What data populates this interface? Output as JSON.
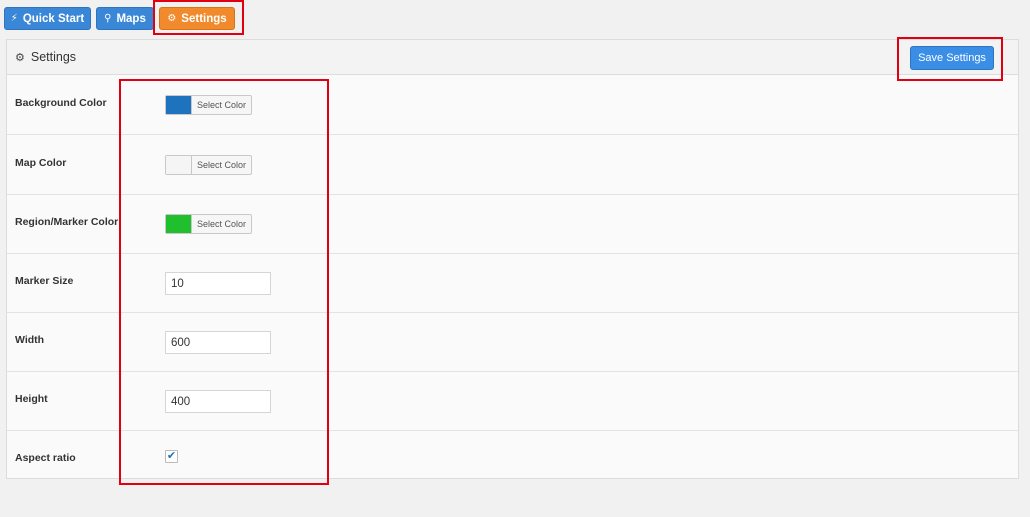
{
  "tabs": [
    {
      "label": "Quick Start",
      "icon": "bolt-icon",
      "color": "#3a87d8"
    },
    {
      "label": "Maps",
      "icon": "map-marker-icon",
      "color": "#3a87d8"
    },
    {
      "label": "Settings",
      "icon": "gear-icon",
      "color": "#f08a2c",
      "active": true
    }
  ],
  "panel": {
    "title": "Settings",
    "save_label": "Save Settings"
  },
  "settings": {
    "background_color": {
      "label": "Background Color",
      "swatch": "#1e73be",
      "button": "Select Color"
    },
    "map_color": {
      "label": "Map Color",
      "swatch": "#f5f5f5",
      "button": "Select Color"
    },
    "region_marker_color": {
      "label": "Region/Marker Color",
      "swatch": "#1fbf2e",
      "button": "Select Color"
    },
    "marker_size": {
      "label": "Marker Size",
      "value": "10"
    },
    "width": {
      "label": "Width",
      "value": "600"
    },
    "height": {
      "label": "Height",
      "value": "400"
    },
    "aspect_ratio": {
      "label": "Aspect ratio",
      "checked": true
    }
  },
  "colors": {
    "highlight": "#e0000f",
    "accent_blue": "#3a87d8",
    "accent_orange": "#f08a2c"
  }
}
